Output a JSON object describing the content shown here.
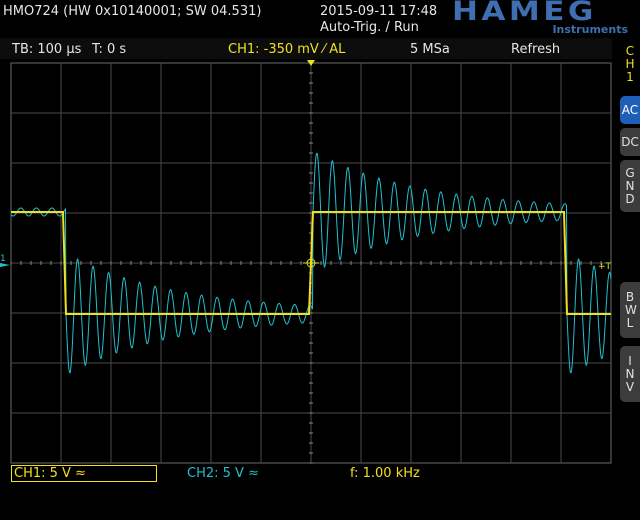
{
  "header": {
    "device": "HMO724 (HW 0x10140001; SW 04.531)",
    "datetime": "2015-09-11 17:48",
    "mode": "Auto-Trig. / Run",
    "brand": "HAMEG",
    "brand_sub": "Instruments"
  },
  "info": {
    "timebase": "TB: 100 µs",
    "trigger_time": "T: 0 s",
    "ch1_trigger": "CH1: -350 mV ⁄ AL",
    "sample_rate": "5 MSa",
    "mode": "Refresh"
  },
  "side_menu": {
    "channel": [
      "C",
      "H",
      "1"
    ],
    "buttons": [
      {
        "label": "AC",
        "active": true
      },
      {
        "label": "DC",
        "active": false
      },
      {
        "label": "GND",
        "active": false
      },
      {
        "label": "BWL",
        "active": false
      },
      {
        "label": "INV",
        "active": false
      }
    ]
  },
  "markers": {
    "ch1_ref": "1",
    "trigger_right": "+T"
  },
  "bottom": {
    "ch1": "CH1: 5 V ≈",
    "ch2": "CH2: 5 V ≈",
    "frequency": "f: 1.00 kHz"
  },
  "colors": {
    "ch1": "#f0e020",
    "ch2": "#20c0d0",
    "grid": "#4a4a4a",
    "active_button": "#1f5fb8",
    "brand": "#3f6fb0"
  }
}
